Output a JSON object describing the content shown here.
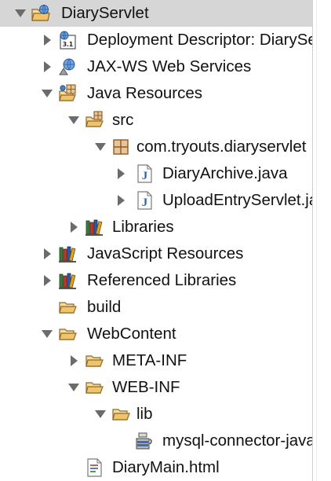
{
  "explorer": {
    "items": [
      {
        "label": "DiaryServlet",
        "icon": "web-project-icon",
        "expander": "expanded",
        "selected": true
      },
      {
        "label": "Deployment Descriptor: DiaryServlet",
        "icon": "deployment-descriptor-icon",
        "expander": "collapsed"
      },
      {
        "label": "JAX-WS Web Services",
        "icon": "web-services-icon",
        "expander": "collapsed"
      },
      {
        "label": "Java Resources",
        "icon": "java-resources-icon",
        "expander": "expanded"
      },
      {
        "label": "src",
        "icon": "source-folder-icon",
        "expander": "expanded"
      },
      {
        "label": "com.tryouts.diaryservlet",
        "icon": "package-icon",
        "expander": "expanded"
      },
      {
        "label": "DiaryArchive.java",
        "icon": "java-file-icon",
        "expander": "collapsed"
      },
      {
        "label": "UploadEntryServlet.java",
        "icon": "java-file-icon",
        "expander": "collapsed"
      },
      {
        "label": "Libraries",
        "icon": "libraries-icon",
        "expander": "collapsed"
      },
      {
        "label": "JavaScript Resources",
        "icon": "libraries-icon",
        "expander": "collapsed"
      },
      {
        "label": "Referenced Libraries",
        "icon": "libraries-icon",
        "expander": "collapsed"
      },
      {
        "label": "build",
        "icon": "folder-icon",
        "expander": "none"
      },
      {
        "label": "WebContent",
        "icon": "folder-icon",
        "expander": "expanded"
      },
      {
        "label": "META-INF",
        "icon": "folder-icon",
        "expander": "collapsed"
      },
      {
        "label": "WEB-INF",
        "icon": "folder-icon",
        "expander": "expanded"
      },
      {
        "label": "lib",
        "icon": "folder-icon",
        "expander": "expanded"
      },
      {
        "label": "mysql-connector-java.jar",
        "icon": "jar-file-icon",
        "expander": "none"
      },
      {
        "label": "DiaryMain.html",
        "icon": "html-file-icon",
        "expander": "none"
      }
    ]
  },
  "colors": {
    "selection": "#d6d6d6",
    "twisty": "#6b6b6b",
    "folder": "#f1c46b",
    "java_blue": "#2f5fb3"
  }
}
